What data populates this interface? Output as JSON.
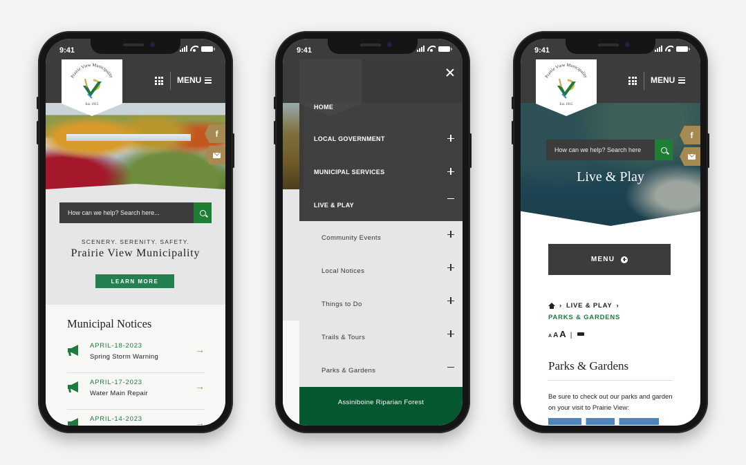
{
  "status_bar": {
    "time": "9:41"
  },
  "brand": {
    "logo_text": "Prairie View Municipality",
    "logo_est": "Est. 1915",
    "colors": {
      "green": "#1e7e34",
      "dark_green": "#04572f",
      "charcoal": "#3c3c3c",
      "gold": "#a68a52",
      "background": "#f3f3f3"
    }
  },
  "header": {
    "menu_label": "MENU",
    "apps_icon": "grid-icon",
    "menu_icon": "hamburger-icon"
  },
  "social": [
    {
      "name": "facebook",
      "glyph": "f"
    },
    {
      "name": "email",
      "glyph": "envelope"
    }
  ],
  "search": {
    "placeholder": "How can we help? Search here...",
    "placeholder_truncated": "How can we help? Search here"
  },
  "phone1": {
    "tagline": "SCENERY. SERENITY. SAFETY.",
    "site_title": "Prairie View Municipality",
    "learn_more": "LEARN MORE",
    "notices_title": "Municipal Notices",
    "notices": [
      {
        "date": "APRIL-18-2023",
        "title": "Spring Storm Warning"
      },
      {
        "date": "APRIL-17-2023",
        "title": "Water Main Repair"
      },
      {
        "date": "APRIL-14-2023",
        "title": ""
      }
    ]
  },
  "phone2": {
    "nav_top": [
      {
        "label": "HOME",
        "toggle": ""
      },
      {
        "label": "LOCAL GOVERNMENT",
        "toggle": "plus"
      },
      {
        "label": "MUNICIPAL SERVICES",
        "toggle": "plus"
      },
      {
        "label": "LIVE & PLAY",
        "toggle": "minus"
      }
    ],
    "nav_sub": [
      {
        "label": "Community Events",
        "toggle": "plus"
      },
      {
        "label": "Local Notices",
        "toggle": "plus"
      },
      {
        "label": "Things to Do",
        "toggle": "plus"
      },
      {
        "label": "Trails & Tours",
        "toggle": "plus"
      },
      {
        "label": "Parks & Gardens",
        "toggle": "minus"
      }
    ],
    "nav_active_child": "Assiniboine Riparian Forest"
  },
  "phone3": {
    "hero_title": "Live & Play",
    "menu_button": "MENU",
    "breadcrumb": {
      "parent": "LIVE & PLAY",
      "current": "PARKS & GARDENS"
    },
    "text_size": [
      "A",
      "A",
      "A"
    ],
    "separator": "|",
    "page_title": "Parks & Gardens",
    "intro": "Be sure to check out our parks and garden on your visit to Prairie View:"
  }
}
